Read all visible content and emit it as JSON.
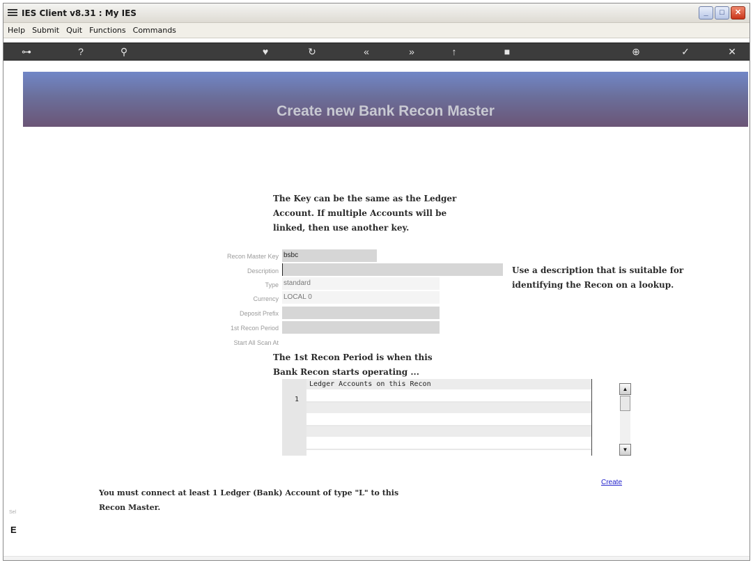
{
  "window": {
    "title": "IES Client v8.31 : My IES",
    "controls": {
      "minimize": "_",
      "maximize": "□",
      "close": "✕"
    }
  },
  "menubar": {
    "items": [
      "Help",
      "Submit",
      "Quit",
      "Functions",
      "Commands"
    ]
  },
  "banner": {
    "title": "Create new Bank Recon Master"
  },
  "hints": {
    "key_hint": [
      "The Key can be the same as the Ledger",
      "Account. If multiple Accounts will be",
      "linked, then use another key."
    ],
    "description_hint": [
      "Use a description that is suitable for",
      "identifying the Recon on a lookup."
    ],
    "period_hint": [
      "The 1st Recon Period is when this",
      "Bank Recon starts operating ..."
    ]
  },
  "form": {
    "recon_master_key": {
      "label": "Recon Master Key",
      "value": "bsbc"
    },
    "description": {
      "label": "Description",
      "value": ""
    },
    "type": {
      "label": "Type",
      "value": "standard"
    },
    "currency": {
      "label": "Currency",
      "value": "LOCAL 0"
    },
    "deposit_prefix": {
      "label": "Deposit Prefix",
      "value": ""
    },
    "first_recon_period": {
      "label": "1st Recon Period",
      "value": ""
    },
    "start_all_scan_at": {
      "label": "Start All Scan At",
      "value": ""
    }
  },
  "grid": {
    "header": "Ledger Accounts on this Recon",
    "row_number": "1"
  },
  "actions": {
    "create": "Create"
  },
  "footer_note": [
    "You must connect at least  1 Ledger  (Bank) Account of type  \"L\" to this",
    "Recon Master."
  ],
  "sidebar": {
    "label": "Sel",
    "icon_glyph": "E"
  }
}
